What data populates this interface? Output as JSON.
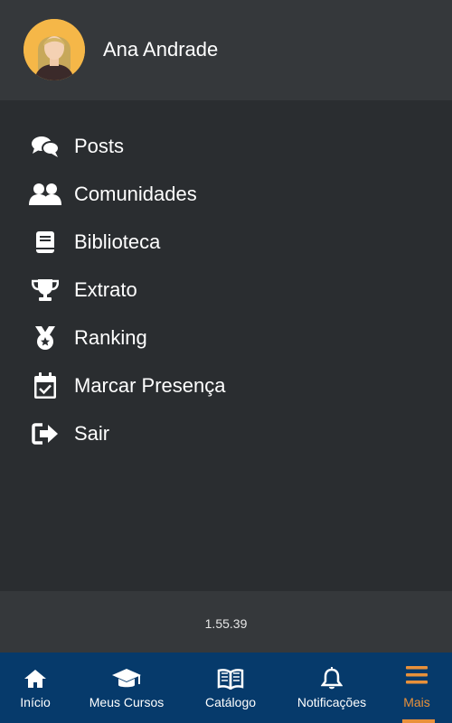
{
  "user": {
    "name": "Ana Andrade"
  },
  "menu": {
    "items": [
      {
        "label": "Posts",
        "icon": "comments-icon"
      },
      {
        "label": "Comunidades",
        "icon": "users-icon"
      },
      {
        "label": "Biblioteca",
        "icon": "book-icon"
      },
      {
        "label": "Extrato",
        "icon": "trophy-icon"
      },
      {
        "label": "Ranking",
        "icon": "medal-icon"
      },
      {
        "label": "Marcar Presença",
        "icon": "calendar-check-icon"
      },
      {
        "label": "Sair",
        "icon": "sign-out-icon"
      }
    ]
  },
  "footer": {
    "version": "1.55.39"
  },
  "tabbar": {
    "tabs": [
      {
        "label": "Início",
        "icon": "home-icon"
      },
      {
        "label": "Meus Cursos",
        "icon": "graduation-cap-icon"
      },
      {
        "label": "Catálogo",
        "icon": "open-book-icon"
      },
      {
        "label": "Notificações",
        "icon": "bell-icon"
      },
      {
        "label": "Mais",
        "icon": "menu-icon",
        "active": true
      }
    ]
  },
  "colors": {
    "header_bg": "#35383b",
    "menu_bg": "#2a2d30",
    "tabbar_bg": "#063a6b",
    "accent": "#e9913a",
    "avatar_bg": "#f5b748"
  }
}
